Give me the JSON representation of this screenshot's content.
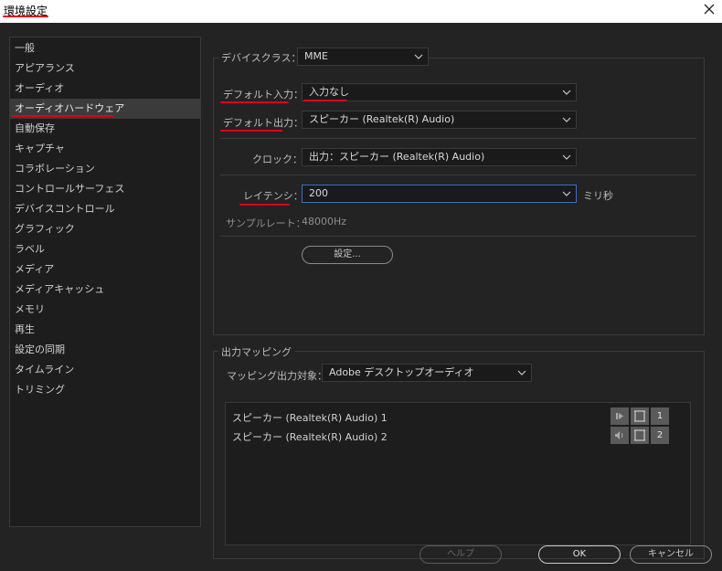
{
  "window": {
    "title": "環境設定",
    "close_icon": "close-icon"
  },
  "sidebar": {
    "items": [
      {
        "label": "一般"
      },
      {
        "label": "アピアランス"
      },
      {
        "label": "オーディオ"
      },
      {
        "label": "オーディオハードウェア",
        "selected": true
      },
      {
        "label": "自動保存"
      },
      {
        "label": "キャプチャ"
      },
      {
        "label": "コラボレーション"
      },
      {
        "label": "コントロールサーフェス"
      },
      {
        "label": "デバイスコントロール"
      },
      {
        "label": "グラフィック"
      },
      {
        "label": "ラベル"
      },
      {
        "label": "メディア"
      },
      {
        "label": "メディアキャッシュ"
      },
      {
        "label": "メモリ"
      },
      {
        "label": "再生"
      },
      {
        "label": "設定の同期"
      },
      {
        "label": "タイムライン"
      },
      {
        "label": "トリミング"
      }
    ]
  },
  "device": {
    "class_label": "デバイスクラス：",
    "class_value": "MME",
    "default_input_label": "デフォルト入力：",
    "default_input_value": "入力なし",
    "default_output_label": "デフォルト出力：",
    "default_output_value": "スピーカー (Realtek(R) Audio)",
    "clock_label": "クロック：",
    "clock_value": "出力：スピーカー (Realtek(R) Audio)",
    "latency_label": "レイテンシ：",
    "latency_value": "200",
    "latency_unit": "ミリ秒",
    "sample_rate_label": "サンプルレート：",
    "sample_rate_value": "48000Hz",
    "settings_button": "設定..."
  },
  "output_mapping": {
    "group_title": "出力マッピング",
    "target_label": "マッピング出力対象：",
    "target_value": "Adobe デスクトップオーディオ",
    "rows": [
      {
        "label": "スピーカー (Realtek(R) Audio) 1",
        "channel": "1"
      },
      {
        "label": "スピーカー (Realtek(R) Audio) 2",
        "channel": "2"
      }
    ]
  },
  "footer": {
    "help_label": "ヘルプ",
    "ok_label": "OK",
    "cancel_label": "キャンセル"
  },
  "colors": {
    "background": "#232323",
    "annotation_red": "#e0001a",
    "focus_blue": "#3a6fc9"
  }
}
